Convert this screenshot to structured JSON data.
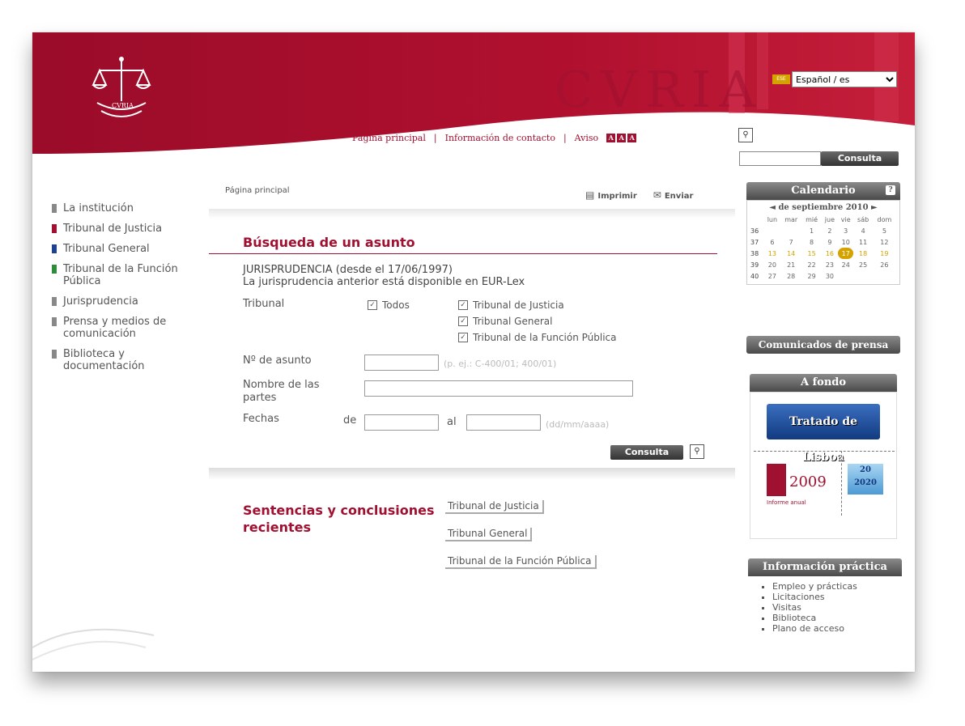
{
  "header": {
    "language": "Español / es",
    "lang_flag": "ESE",
    "nav": [
      {
        "label": "Página principal"
      },
      {
        "label": "Información de contacto"
      },
      {
        "label": "Aviso"
      }
    ],
    "separator": "|",
    "text_sizes": [
      "A",
      "A",
      "A"
    ],
    "search_button": "Consulta",
    "logo_text": "CVRIA",
    "watermark": "CVRIA"
  },
  "sidebar": {
    "items": [
      {
        "label": "La institución",
        "color": "#888888"
      },
      {
        "label": "Tribunal de Justicia",
        "color": "#a01030"
      },
      {
        "label": "Tribunal General",
        "color": "#1f3f8f"
      },
      {
        "label": "Tribunal de la Función Pública",
        "color": "#2e8b3a"
      },
      {
        "label": "Jurisprudencia",
        "color": "#888888"
      },
      {
        "label": "Prensa y medios de comunicación",
        "color": "#888888"
      },
      {
        "label": "Biblioteca y documentación",
        "color": "#888888"
      }
    ]
  },
  "content": {
    "breadcrumb": "Página principal",
    "print_label": "Imprimir",
    "send_label": "Enviar",
    "title": "Búsqueda de un asunto",
    "juris_line1": "JURISPRUDENCIA (desde el 17/06/1997)",
    "juris_line2": "La jurisprudencia anterior está disponible en EUR-Lex",
    "form": {
      "tribunal_label": "Tribunal",
      "all_label": "Todos",
      "checks": [
        "Tribunal de Justicia",
        "Tribunal General",
        "Tribunal de la Función Pública"
      ],
      "case_label": "Nº de asunto",
      "case_hint": "(p. ej.: C-400/01; 400/01)",
      "parties_label": "Nombre de las partes",
      "dates_label": "Fechas",
      "from_label": "de",
      "to_label": "al",
      "date_hint": "(dd/mm/aaaa)",
      "submit": "Consulta"
    },
    "recent_title": "Sentencias y conclusiones recientes",
    "recent_links": [
      "Tribunal de Justicia",
      "Tribunal General",
      "Tribunal de la Función Pública"
    ]
  },
  "right": {
    "calendar_title": "Calendario",
    "calendar_help": "?",
    "month": "◄ de septiembre 2010 ►",
    "weekdays": [
      "lun",
      "mar",
      "mié",
      "jue",
      "vie",
      "sáb",
      "dom"
    ],
    "weeks": [
      {
        "wk": "36",
        "days": [
          "",
          "",
          "1",
          "2",
          "3",
          "4",
          "5"
        ]
      },
      {
        "wk": "37",
        "days": [
          "6",
          "7",
          "8",
          "9",
          "10",
          "11",
          "12"
        ]
      },
      {
        "wk": "38",
        "days": [
          "13",
          "14",
          "15",
          "16",
          "17",
          "18",
          "19"
        ]
      },
      {
        "wk": "39",
        "days": [
          "20",
          "21",
          "22",
          "23",
          "24",
          "25",
          "26"
        ]
      },
      {
        "wk": "40",
        "days": [
          "27",
          "28",
          "29",
          "30",
          "",
          "",
          ""
        ]
      }
    ],
    "today": "17",
    "press_button": "Comunicados de prensa",
    "afondo_title": "A fondo",
    "lisboa": "Tratado de Lisboa",
    "informe_year": "2009",
    "informe_caption": "Informe anual",
    "e2020": "20 2020",
    "info_title": "Información práctica",
    "info_items": [
      "Empleo y prácticas",
      "Licitaciones",
      "Visitas",
      "Biblioteca",
      "Plano de acceso"
    ]
  }
}
